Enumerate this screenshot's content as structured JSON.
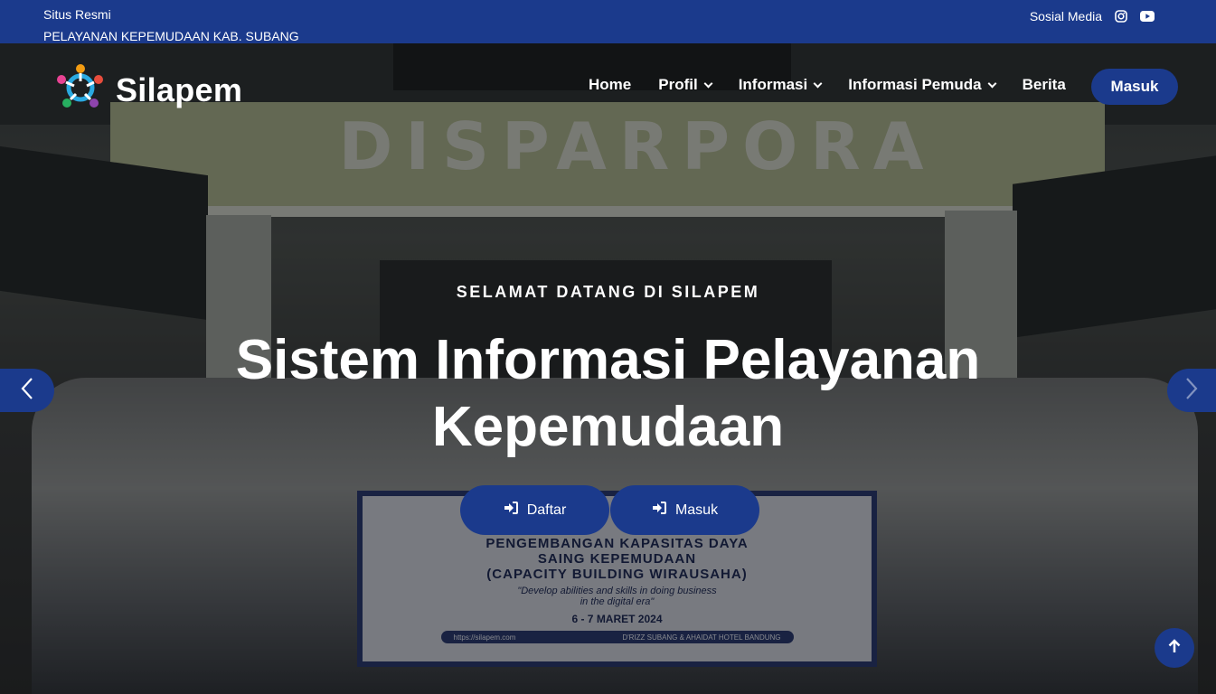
{
  "topbar": {
    "line1": "Situs Resmi",
    "line2": "PELAYANAN KEPEMUDAAN KAB. SUBANG",
    "social_label": "Sosial Media",
    "icons": [
      "instagram-icon",
      "youtube-icon"
    ]
  },
  "nav": {
    "brand": "Silapem",
    "items": [
      {
        "label": "Home",
        "dropdown": false
      },
      {
        "label": "Profil",
        "dropdown": true
      },
      {
        "label": "Informasi",
        "dropdown": true
      },
      {
        "label": "Informasi Pemuda",
        "dropdown": true
      },
      {
        "label": "Berita",
        "dropdown": false
      }
    ],
    "login_label": "Masuk"
  },
  "hero": {
    "subtitle": "SELAMAT DATANG DI SILAPEM",
    "title": "Sistem Informasi Pelayanan Kepemudaan",
    "sign_text": "DISPARPORA",
    "banner": {
      "line1": "PENGEMBANGAN KAPASITAS DAYA",
      "line2": "SAING KEPEMUDAAN",
      "line3": "(CAPACITY BUILDING WIRAUSAHA)",
      "tagline1": "\"Develop abilities and skills in doing business",
      "tagline2": "in the digital era\"",
      "date": "6 - 7 MARET 2024",
      "url": "https://silapem.com",
      "venue": "D'RIZZ SUBANG & AHAIDAT HOTEL BANDUNG"
    },
    "buttons": {
      "daftar": "Daftar",
      "masuk": "Masuk"
    }
  },
  "colors": {
    "primary": "#1b3a8c",
    "text": "#ffffff"
  }
}
